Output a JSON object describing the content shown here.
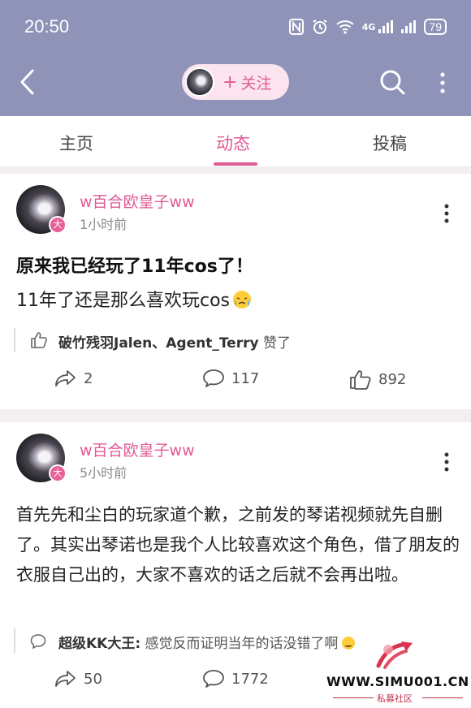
{
  "status_bar": {
    "time": "20:50",
    "network": "4G",
    "battery": "79"
  },
  "header": {
    "follow_plus": "+",
    "follow_label": "关注"
  },
  "tabs": [
    {
      "label": "主页",
      "active": false
    },
    {
      "label": "动态",
      "active": true
    },
    {
      "label": "投稿",
      "active": false
    }
  ],
  "posts": [
    {
      "author": "w百合欧皇子ww",
      "badge": "大",
      "time": "1小时前",
      "title": "原来我已经玩了11年cos了！",
      "body": "11年了还是那么喜欢玩cos",
      "likes_users": "破竹残羽Jalen、Agent_Terry",
      "likes_suffix": " 赞了",
      "shares": "2",
      "comments": "117",
      "likes": "892"
    },
    {
      "author": "w百合欧皇子ww",
      "badge": "大",
      "time": "5小时前",
      "body": "首先先和尘白的玩家道个歉，之前发的琴诺视频就先自删了。其实出琴诺也是我个人比较喜欢这个角色，借了朋友的衣服自己出的，大家不喜欢的话之后就不会再出啦。",
      "comment_user": "超级KK大王:",
      "comment_text": " 感觉反而证明当年的话没错了啊",
      "shares": "50",
      "comments": "1772"
    }
  ],
  "watermark": {
    "site": "WWW.SIMU001.CN",
    "sub": "私募社区"
  },
  "colors": {
    "header_bg": "#8f93b8",
    "accent": "#e05a93"
  }
}
